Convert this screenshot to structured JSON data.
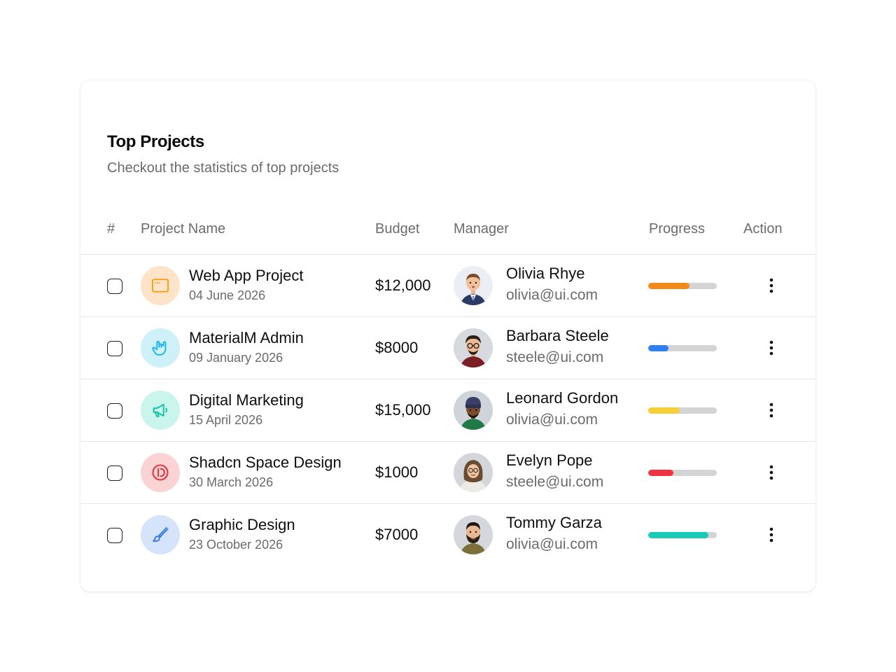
{
  "header": {
    "title": "Top Projects",
    "subtitle": "Checkout the statistics of top projects"
  },
  "columns": [
    "#",
    "Project Name",
    "Budget",
    "Manager",
    "Progress",
    "Action"
  ],
  "rows": [
    {
      "name": "Web App Project",
      "date": "04 June 2026",
      "icon": "browser-window-icon",
      "icon_color": "#f59e0b",
      "icon_bg": "#fde3c8",
      "budget": "$12,000",
      "manager": {
        "name": "Olivia Rhye",
        "email": "olivia@ui.com",
        "avatar": "avatar-tie"
      },
      "progress": 0.6,
      "progress_color": "#f28a1a"
    },
    {
      "name": "MaterialM Admin",
      "date": "09 January 2026",
      "icon": "hand-rock-icon",
      "icon_color": "#12b3e6",
      "icon_bg": "#cdf0f9",
      "budget": "$8000",
      "manager": {
        "name": "Barbara Steele",
        "email": "steele@ui.com",
        "avatar": "avatar-glasses"
      },
      "progress": 0.3,
      "progress_color": "#2f7ff2"
    },
    {
      "name": "Digital Marketing",
      "date": "15 April 2026",
      "icon": "megaphone-icon",
      "icon_color": "#14c3a6",
      "icon_bg": "#c9f5ec",
      "budget": "$15,000",
      "manager": {
        "name": "Leonard Gordon",
        "email": "olivia@ui.com",
        "avatar": "avatar-beanie"
      },
      "progress": 0.46,
      "progress_color": "#f5cf35"
    },
    {
      "name": "Shadcn Space Design",
      "date": "30 March 2026",
      "icon": "shadcn-logo-icon",
      "icon_color": "#e8333d",
      "icon_bg": "#fbd3d4",
      "budget": "$1000",
      "manager": {
        "name": "Evelyn Pope",
        "email": "steele@ui.com",
        "avatar": "avatar-hijab"
      },
      "progress": 0.37,
      "progress_color": "#ef3340"
    },
    {
      "name": "Graphic Design",
      "date": "23 October 2026",
      "icon": "paintbrush-icon",
      "icon_color": "#3b7fe6",
      "icon_bg": "#d5e4fb",
      "budget": "$7000",
      "manager": {
        "name": "Tommy Garza",
        "email": "olivia@ui.com",
        "avatar": "avatar-beard"
      },
      "progress": 0.88,
      "progress_color": "#17ccb6"
    }
  ]
}
